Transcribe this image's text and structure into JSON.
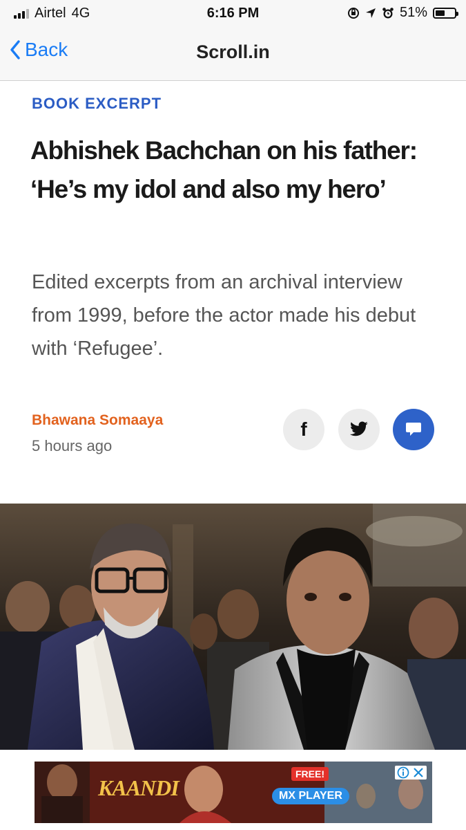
{
  "status_bar": {
    "carrier": "Airtel",
    "network": "4G",
    "time": "6:16 PM",
    "battery_percent": "51%",
    "battery_level": 0.51,
    "icons": [
      "signal-icon",
      "screen-rotation-lock-icon",
      "location-arrow-icon",
      "alarm-icon",
      "battery-icon"
    ]
  },
  "nav": {
    "back_label": "Back",
    "title": "Scroll.in"
  },
  "article": {
    "category": "BOOK EXCERPT",
    "headline": "Abhishek Bachchan on his father: ‘He’s my idol and also my hero’",
    "subhead": "Edited excerpts from an archival interview from 1999, before the actor made his debut with ‘Refugee’.",
    "author": "Bhawana Somaaya",
    "timestamp": "5 hours ago"
  },
  "share": {
    "facebook_glyph": "f",
    "icons": [
      "facebook-icon",
      "twitter-icon",
      "comment-icon"
    ]
  },
  "colors": {
    "accent_blue": "#2e62c9",
    "ios_blue": "#1a7cf5",
    "author_orange": "#e2621e",
    "category_blue": "#2b5cc4"
  },
  "ad": {
    "title": "KAANDI",
    "badge": "FREE!",
    "brand": "MX PLAYER"
  }
}
